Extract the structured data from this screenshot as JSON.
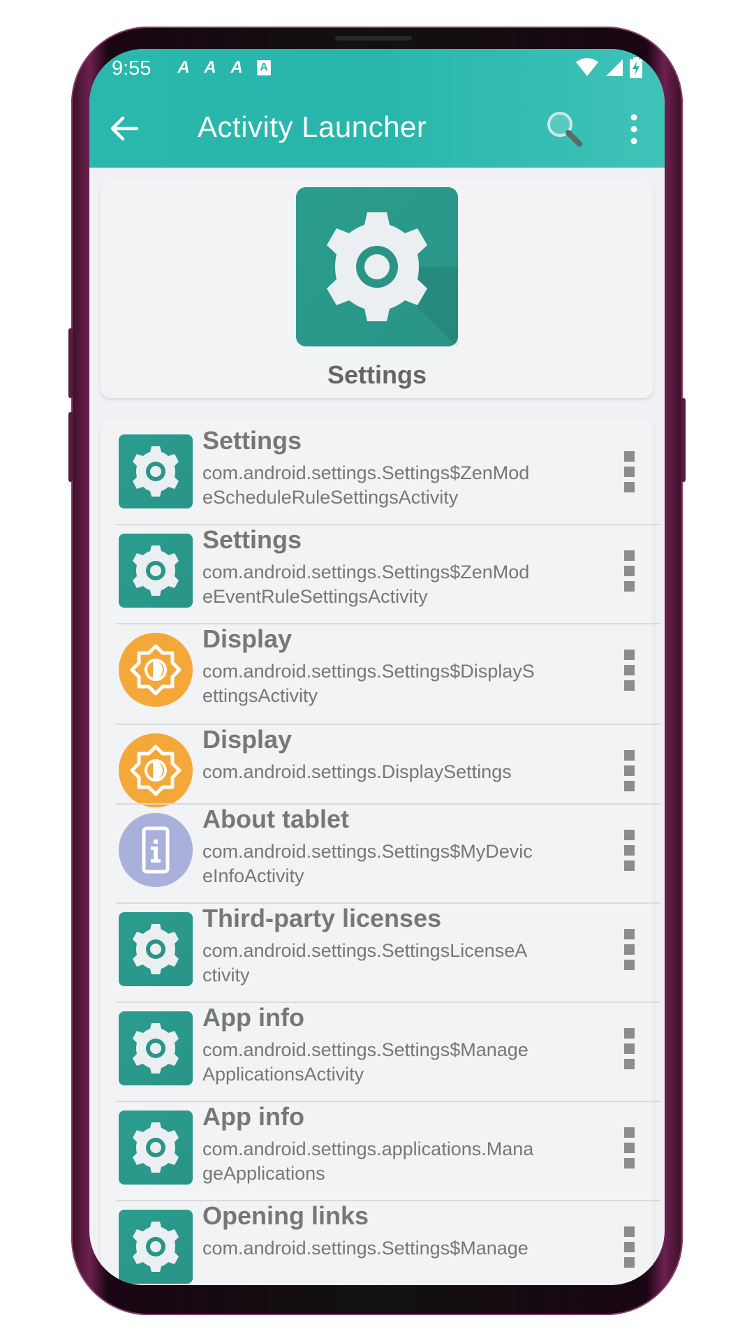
{
  "status_bar": {
    "time": "9:55",
    "notification_icons": [
      "A",
      "A",
      "A",
      "A"
    ]
  },
  "toolbar": {
    "title": "Activity Launcher",
    "back_icon": "arrow-back-icon",
    "search_icon": "search-icon",
    "more_icon": "more-vert-icon"
  },
  "header": {
    "app_name": "Settings",
    "icon": "settings-gear-icon"
  },
  "activities": [
    {
      "title": "Settings",
      "lines": [
        "com.android.settings.Settings$ZenMod",
        "eScheduleRuleSettingsActivity"
      ],
      "icon": "settings-gear-icon"
    },
    {
      "title": "Settings",
      "lines": [
        "com.android.settings.Settings$ZenMod",
        "eEventRuleSettingsActivity"
      ],
      "icon": "settings-gear-icon"
    },
    {
      "title": "Display",
      "lines": [
        "com.android.settings.Settings$DisplayS",
        "ettingsActivity"
      ],
      "icon": "display-brightness-icon"
    },
    {
      "title": "Display",
      "lines": [
        "com.android.settings.DisplaySettings"
      ],
      "icon": "display-brightness-icon"
    },
    {
      "title": "About tablet",
      "lines": [
        "com.android.settings.Settings$MyDevic",
        "eInfoActivity"
      ],
      "icon": "device-info-icon"
    },
    {
      "title": "Third-party licenses",
      "lines": [
        "com.android.settings.SettingsLicenseA",
        "ctivity"
      ],
      "icon": "settings-gear-icon"
    },
    {
      "title": "App info",
      "lines": [
        "com.android.settings.Settings$Manage",
        "ApplicationsActivity"
      ],
      "icon": "settings-gear-icon"
    },
    {
      "title": "App info",
      "lines": [
        "com.android.settings.applications.Mana",
        "geApplications"
      ],
      "icon": "settings-gear-icon"
    },
    {
      "title": "Opening links",
      "lines": [
        "com.android.settings.Settings$Manage"
      ],
      "icon": "settings-gear-icon"
    }
  ],
  "colors": {
    "accent": "#2ab7ad",
    "icon_teal": "#2a9487",
    "icon_orange": "#f4a83a",
    "icon_purple": "#a9b0dc"
  }
}
